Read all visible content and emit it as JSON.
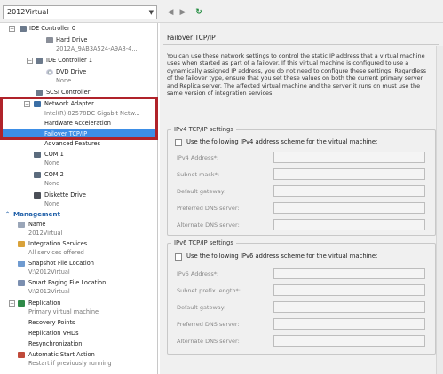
{
  "toolbar": {
    "vm_name": "2012Virtual",
    "back": "◀",
    "forward": "▶",
    "refresh": "↻"
  },
  "tree": {
    "items": [
      {
        "label": "IDE Controller 0",
        "sub": ""
      },
      {
        "label": "Hard Drive",
        "sub": "2012A_9AB3A524-A9A8-4..."
      },
      {
        "label": "IDE Controller 1",
        "sub": ""
      },
      {
        "label": "DVD Drive",
        "sub": "None"
      },
      {
        "label": "SCSI Controller",
        "sub": ""
      },
      {
        "label": "Network Adapter",
        "sub": "Intel(R) 82578DC Gigabit Netw..."
      },
      {
        "label": "Hardware Acceleration",
        "sub": ""
      },
      {
        "label": "Failover TCP/IP",
        "sub": ""
      },
      {
        "label": "Advanced Features",
        "sub": ""
      },
      {
        "label": "COM 1",
        "sub": "None"
      },
      {
        "label": "COM 2",
        "sub": "None"
      },
      {
        "label": "Diskette Drive",
        "sub": "None"
      }
    ],
    "management_header": "Management",
    "management": [
      {
        "label": "Name",
        "sub": "2012Virtual"
      },
      {
        "label": "Integration Services",
        "sub": "All services offered"
      },
      {
        "label": "Snapshot File Location",
        "sub": "V:\\2012Virtual"
      },
      {
        "label": "Smart Paging File Location",
        "sub": "V:\\2012Virtual"
      },
      {
        "label": "Replication",
        "sub": "Primary virtual machine"
      },
      {
        "label": "Recovery Points",
        "sub": ""
      },
      {
        "label": "Replication VHDs",
        "sub": ""
      },
      {
        "label": "Resynchronization",
        "sub": ""
      },
      {
        "label": "Automatic Start Action",
        "sub": "Restart if previously running"
      }
    ]
  },
  "panel": {
    "title": "Failover TCP/IP",
    "description": "You can use these network settings to control the static IP address that a virtual machine uses when started as part of a failover. If this virtual machine is configured to use a dynamically assigned IP address, you do not need to configure these settings. Regardless of the failover type, ensure that you set these values on both the current primary server and Replica server. The affected virtual machine and the server it runs on must use the same version of integration services.",
    "ipv4": {
      "title": "IPv4 TCP/IP settings",
      "checkbox": "Use the following IPv4 address scheme for the virtual machine:",
      "fields": [
        "IPv4 Address*:",
        "Subnet mask*:",
        "Default gateway:",
        "Preferred DNS server:",
        "Alternate DNS server:"
      ]
    },
    "ipv6": {
      "title": "IPv6 TCP/IP settings",
      "checkbox": "Use the following IPv6 address scheme for the virtual machine:",
      "fields": [
        "IPv6 Address*:",
        "Subnet prefix length*:",
        "Default gateway:",
        "Preferred DNS server:",
        "Alternate DNS server:"
      ]
    }
  },
  "colors": {
    "highlight": "#b0232a",
    "selected": "#3d8ee6",
    "section": "#1f5fa8"
  }
}
